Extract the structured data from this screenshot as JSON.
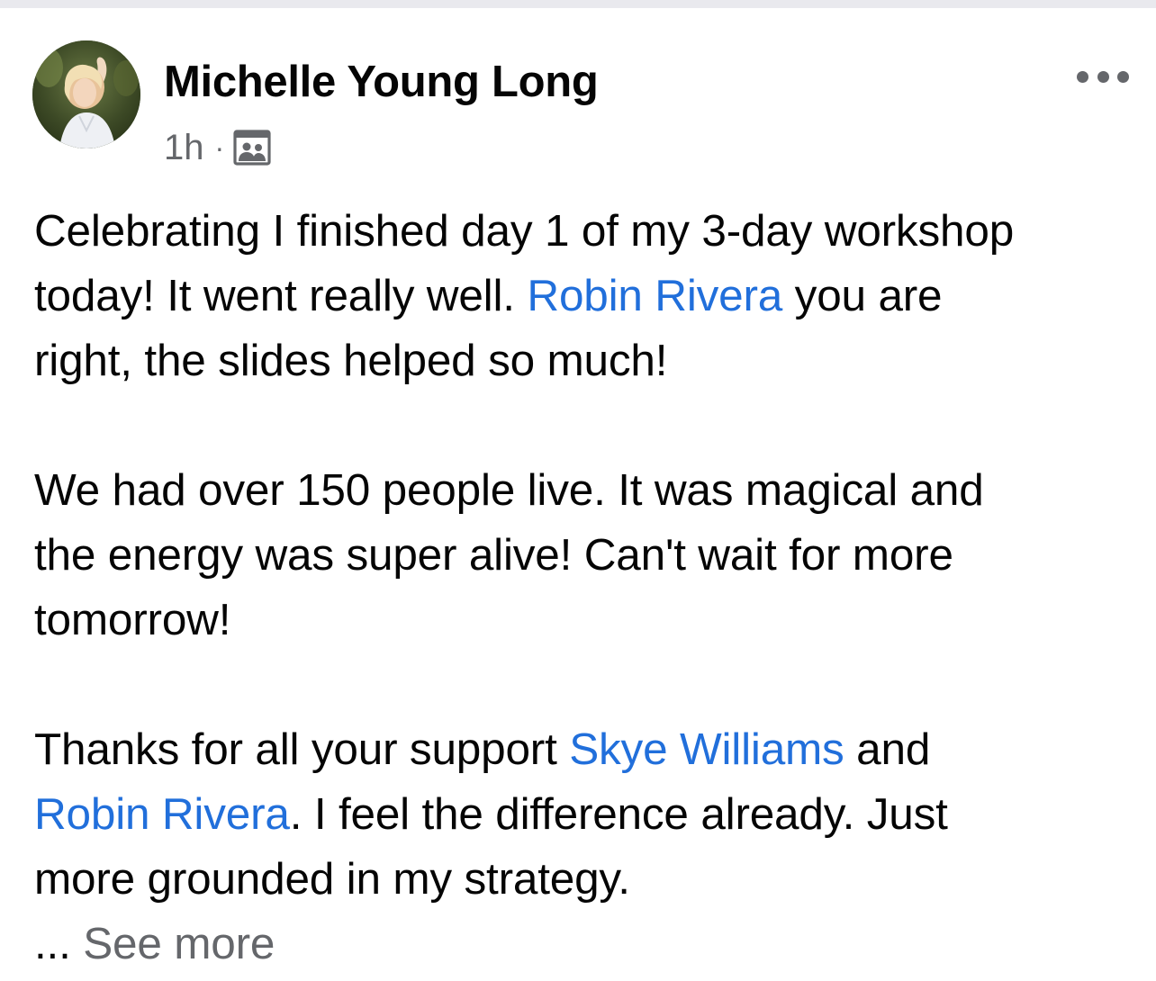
{
  "post": {
    "author": "Michelle Young Long",
    "time": "1h",
    "separator": "·",
    "audience_icon": "group-members-icon",
    "more_icon": "more-options-icon",
    "paragraphs": [
      {
        "lines": [
          [
            {
              "text": "Celebrating I finished day 1 of my 3-day workshop"
            }
          ],
          [
            {
              "text": "today! It went really well. "
            },
            {
              "text": "Robin Rivera",
              "mention": true
            },
            {
              "text": " you are"
            }
          ],
          [
            {
              "text": "right, the slides helped so much!"
            }
          ]
        ]
      },
      {
        "lines": [
          [
            {
              "text": "We had over 150 people live. It was magical and"
            }
          ],
          [
            {
              "text": "the energy was super alive! Can't wait for more"
            }
          ],
          [
            {
              "text": "tomorrow!"
            }
          ]
        ]
      },
      {
        "lines": [
          [
            {
              "text": "Thanks for all your support "
            },
            {
              "text": "Skye Williams",
              "mention": true
            },
            {
              "text": " and"
            }
          ],
          [
            {
              "text": "Robin Rivera",
              "mention": true
            },
            {
              "text": ". I feel the difference already. Just"
            }
          ],
          [
            {
              "text": "more grounded in my strategy."
            }
          ]
        ]
      }
    ],
    "ellipsis": "...",
    "see_more": "See more"
  },
  "colors": {
    "mention": "#216fdb",
    "secondary_text": "#65676b",
    "primary_text": "#050505"
  }
}
